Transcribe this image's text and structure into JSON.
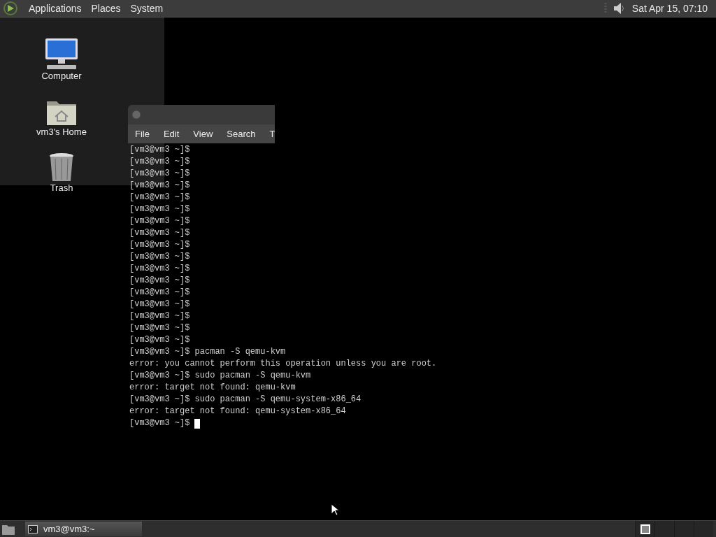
{
  "top_panel": {
    "menus": [
      "Applications",
      "Places",
      "System"
    ],
    "clock": "Sat Apr 15, 07:10"
  },
  "desktop_icons": [
    {
      "kind": "computer",
      "label": "Computer"
    },
    {
      "kind": "home",
      "label": "vm3's Home"
    },
    {
      "kind": "trash",
      "label": "Trash"
    }
  ],
  "terminal": {
    "menus": [
      "File",
      "Edit",
      "View",
      "Search",
      "T"
    ],
    "lines": [
      "[vm3@vm3 ~]$",
      "[vm3@vm3 ~]$",
      "[vm3@vm3 ~]$",
      "[vm3@vm3 ~]$",
      "[vm3@vm3 ~]$",
      "[vm3@vm3 ~]$",
      "[vm3@vm3 ~]$",
      "[vm3@vm3 ~]$",
      "[vm3@vm3 ~]$",
      "[vm3@vm3 ~]$",
      "[vm3@vm3 ~]$",
      "[vm3@vm3 ~]$",
      "[vm3@vm3 ~]$",
      "[vm3@vm3 ~]$",
      "[vm3@vm3 ~]$",
      "[vm3@vm3 ~]$",
      "[vm3@vm3 ~]$",
      "[vm3@vm3 ~]$ pacman -S qemu-kvm",
      "error: you cannot perform this operation unless you are root.",
      "[vm3@vm3 ~]$ sudo pacman -S qemu-kvm",
      "error: target not found: qemu-kvm",
      "[vm3@vm3 ~]$ sudo pacman -S qemu-system-x86_64",
      "error: target not found: qemu-system-x86_64",
      "[vm3@vm3 ~]$"
    ],
    "cursor": true
  },
  "bottom_panel": {
    "tasks": [
      {
        "label": "vm3@vm3:~",
        "selected": false
      }
    ],
    "workspaces": [
      {
        "selected": true
      },
      {
        "selected": false
      },
      {
        "selected": false
      },
      {
        "selected": false
      }
    ]
  }
}
